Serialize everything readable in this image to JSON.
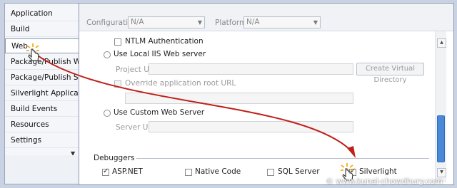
{
  "sidebar": {
    "items": [
      {
        "label": "Application"
      },
      {
        "label": "Build"
      },
      {
        "label": "Web",
        "active": true
      },
      {
        "label": "Package/Publish Web"
      },
      {
        "label": "Package/Publish SQL"
      },
      {
        "label": "Silverlight Applications"
      },
      {
        "label": "Build Events"
      },
      {
        "label": "Resources"
      },
      {
        "label": "Settings"
      }
    ],
    "scroll_arrow": "▼"
  },
  "config_bar": {
    "configuration_label": "Configuration:",
    "configuration_value": "N/A",
    "platform_label": "Platform:",
    "platform_value": "N/A"
  },
  "servers": {
    "ntlm_label": "NTLM Authentication",
    "ntlm_checked": false,
    "use_local_iis_label": "Use Local IIS Web server",
    "project_url_label": "Project Url:",
    "project_url_value": "",
    "create_vdir_label": "Create Virtual Directory",
    "override_label": "Override application root URL",
    "override_value": "",
    "use_custom_label": "Use Custom Web Server",
    "server_url_label": "Server Url:",
    "server_url_value": ""
  },
  "debuggers": {
    "heading": "Debuggers",
    "items": [
      {
        "label": "ASP.NET",
        "checked": true
      },
      {
        "label": "Native Code",
        "checked": false
      },
      {
        "label": "SQL Server",
        "checked": false
      },
      {
        "label": "Silverlight",
        "checked": true
      }
    ]
  },
  "watermark": "© www.kunal-chowdhury.com",
  "colors": {
    "arrow": "#c0201a",
    "scroll_thumb": "#4a88d8",
    "frame": "#c9d2e2"
  }
}
